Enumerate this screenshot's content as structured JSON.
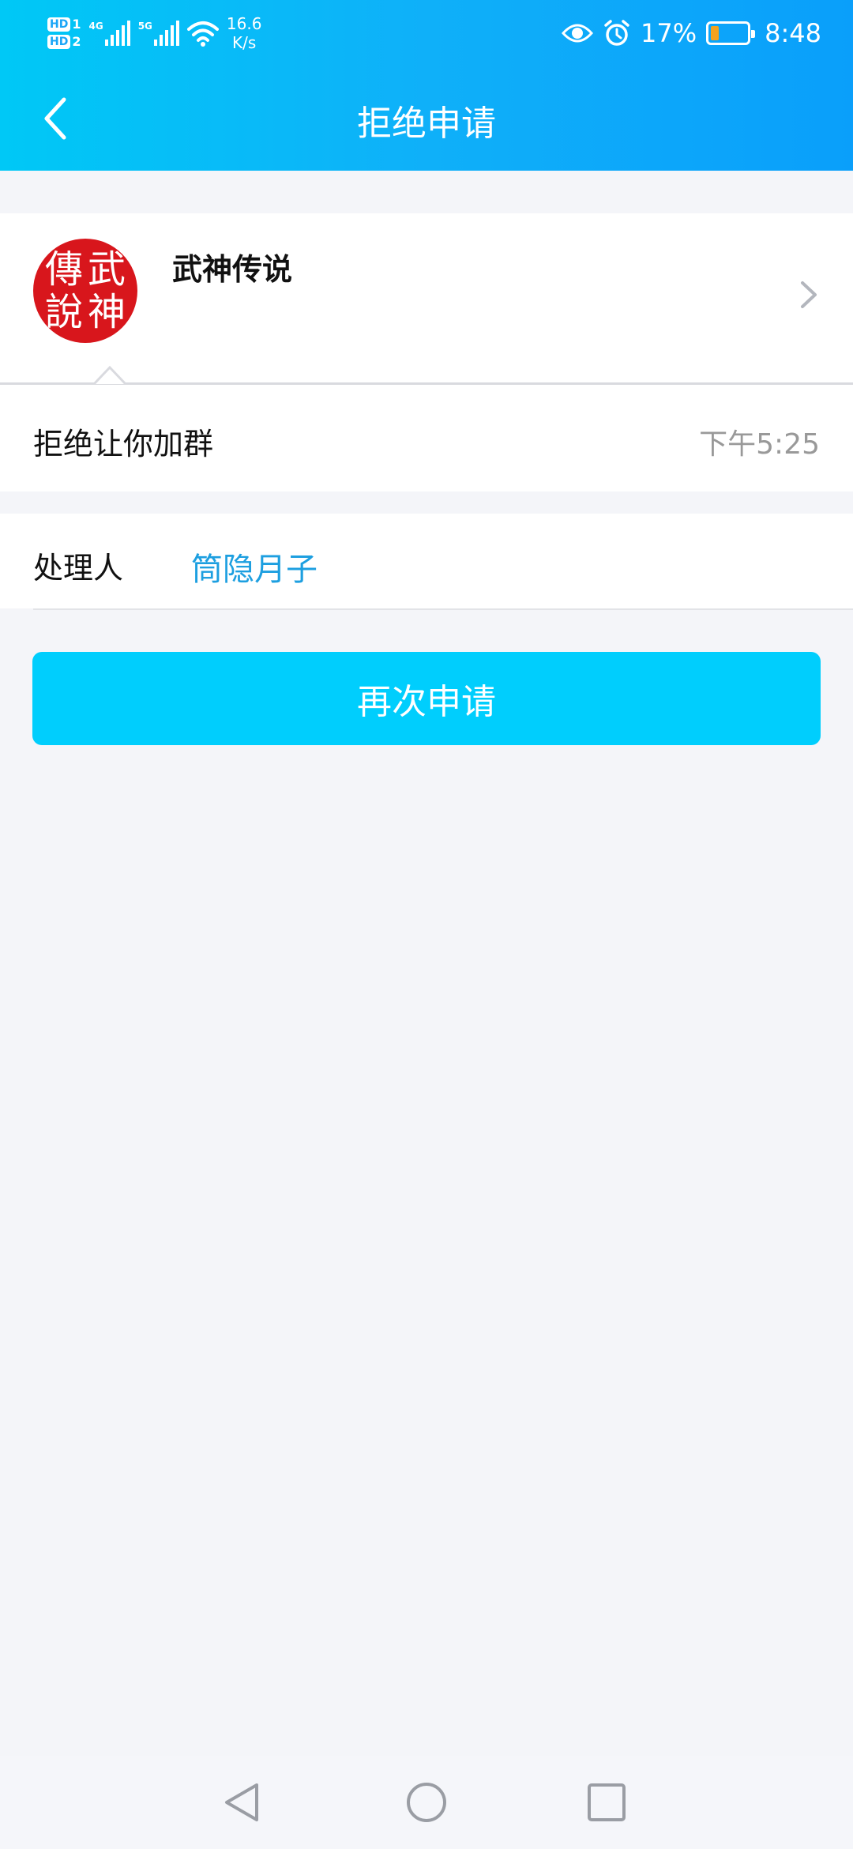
{
  "status_bar": {
    "sim1_label": "HD",
    "sim1_num": "1",
    "sim2_label": "HD",
    "sim2_num": "2",
    "net1": "4G",
    "net2": "5G",
    "speed_value": "16.6",
    "speed_unit": "K/s",
    "battery_percent": "17%",
    "time": "8:48",
    "battery_color": "#f3a21e"
  },
  "header": {
    "title": "拒绝申请",
    "back_icon": "chevron-left-icon"
  },
  "group": {
    "avatar_chars": [
      "傳",
      "武",
      "說",
      "神"
    ],
    "name": "武神传说",
    "message": "拒绝让你加群",
    "time": "下午5:25"
  },
  "handler": {
    "label": "处理人",
    "name": "筒隐月子"
  },
  "actions": {
    "apply_again": "再次申请"
  },
  "colors": {
    "header_start": "#00c8f6",
    "header_end": "#0a9ffa",
    "button": "#00cefd",
    "link": "#1d9fe0"
  }
}
